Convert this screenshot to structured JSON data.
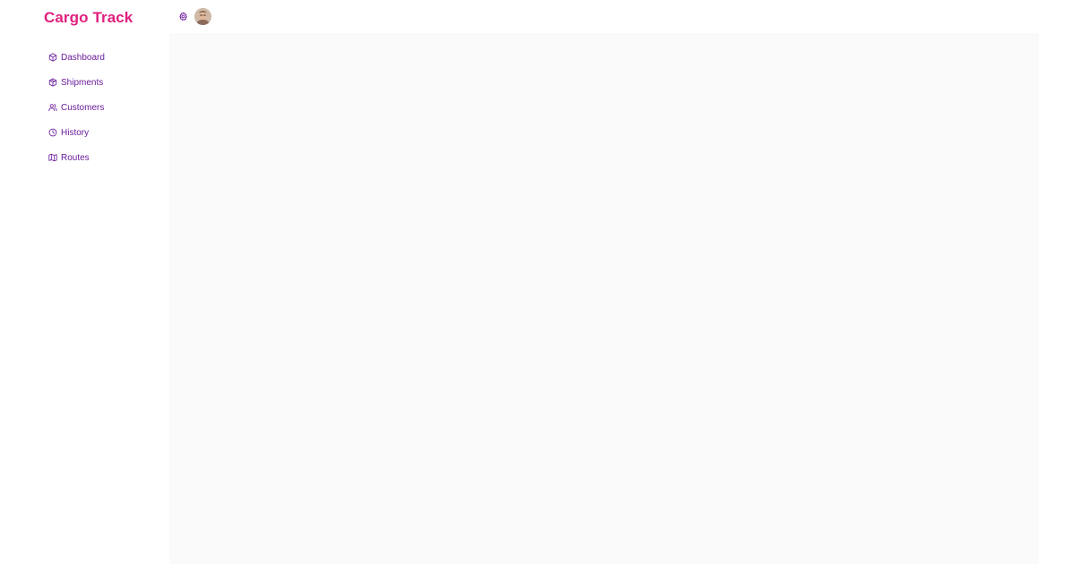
{
  "app": {
    "title": "Cargo Track"
  },
  "colors": {
    "brand": "#e0207e",
    "nav": "#6a1b9a",
    "content_bg": "#fafafa"
  },
  "sidebar": {
    "items": [
      {
        "label": "Dashboard",
        "icon": "cube-icon"
      },
      {
        "label": "Shipments",
        "icon": "package-icon"
      },
      {
        "label": "Customers",
        "icon": "users-icon"
      },
      {
        "label": "History",
        "icon": "clock-icon"
      },
      {
        "label": "Routes",
        "icon": "map-icon"
      }
    ]
  },
  "topbar": {
    "icons": [
      "gear-icon",
      "avatar"
    ]
  }
}
